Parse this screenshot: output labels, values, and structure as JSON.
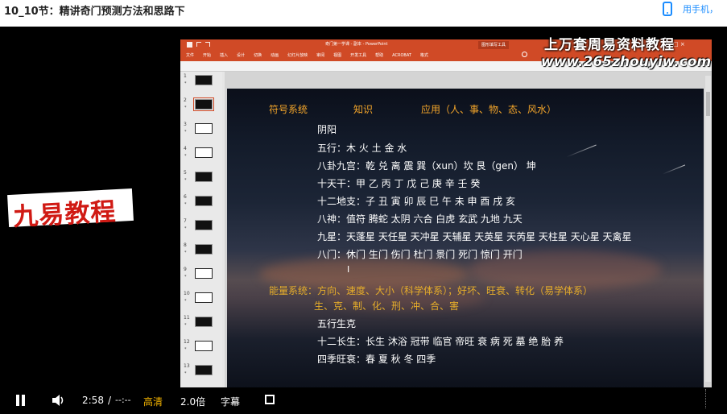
{
  "page": {
    "title": "10_10节：精讲奇门预测方法和思路下",
    "phone_link": "用手机，"
  },
  "overlay": {
    "logo": "九易教程",
    "watermark_title": "上万套周易资料教程",
    "watermark_url": "www.265zhouyiw.com"
  },
  "ppt": {
    "doc_title": "奇门第一学课 - 副本 - PowerPoint",
    "context_tab": "图形填写工具",
    "window_controls": "□ ×",
    "ribbon_tabs": [
      "文件",
      "开始",
      "插入",
      "设计",
      "切换",
      "动画",
      "幻灯片放映",
      "审阅",
      "视图",
      "开发工具",
      "帮助",
      "ACROBAT",
      "格式"
    ],
    "thumbnails": [
      {
        "num": "1",
        "style": "dark"
      },
      {
        "num": "2",
        "style": "dark",
        "selected": true
      },
      {
        "num": "3",
        "style": "light"
      },
      {
        "num": "4",
        "style": "light"
      },
      {
        "num": "5",
        "style": "dark"
      },
      {
        "num": "6",
        "style": "dark"
      },
      {
        "num": "7",
        "style": "dark"
      },
      {
        "num": "8",
        "style": "dark"
      },
      {
        "num": "9",
        "style": "light"
      },
      {
        "num": "10",
        "style": "light"
      },
      {
        "num": "11",
        "style": "dark"
      },
      {
        "num": "12",
        "style": "light"
      },
      {
        "num": "13",
        "style": "dark"
      }
    ],
    "thumb_star": "*"
  },
  "slide": {
    "header_symbol": "符号系统",
    "header_knowledge": "知识",
    "header_application": "应用（人、事、物、态、风水）",
    "yinyang": "阴阳",
    "wuxing": "五行：木 火 土 金 水",
    "bagua": "八卦九宫：乾 兑 离 震 巽（xun）坎 艮（gen） 坤",
    "tiangan": "十天干：甲 乙 丙 丁 戊 己 庚 辛 壬 癸",
    "dizhi": "十二地支：子 丑 寅 卯 辰 巳 午 未 申 酉 戌 亥",
    "bashen": "八神：值符 腾蛇 太阴 六合 白虎 玄武 九地 九天",
    "jiuxing": "九星：天蓬星 天任星 天冲星 天辅星 天英星 天芮星 天柱星 天心星  天禽星",
    "bamen": "八门：休门  生门  伤门  杜门  景门  死门  惊门  开门",
    "cursor": "I",
    "energy_line1": "能量系统：方向、速度、大小（科学体系）；好坏、旺衰、转化（易学体系）",
    "energy_line2": "生、克、制、化、刑、冲、合、害",
    "shengke": "五行生克",
    "changsheng": "十二长生：长生 沐浴 冠带 临官 帝旺 衰 病 死 墓 绝 胎 养",
    "siji": "四季旺衰：春  夏  秋  冬  四季"
  },
  "controls": {
    "time_current": "2:58",
    "time_sep": "/",
    "time_total": "--:--",
    "quality": "高清",
    "speed": "2.0倍",
    "subtitle": "字幕"
  }
}
